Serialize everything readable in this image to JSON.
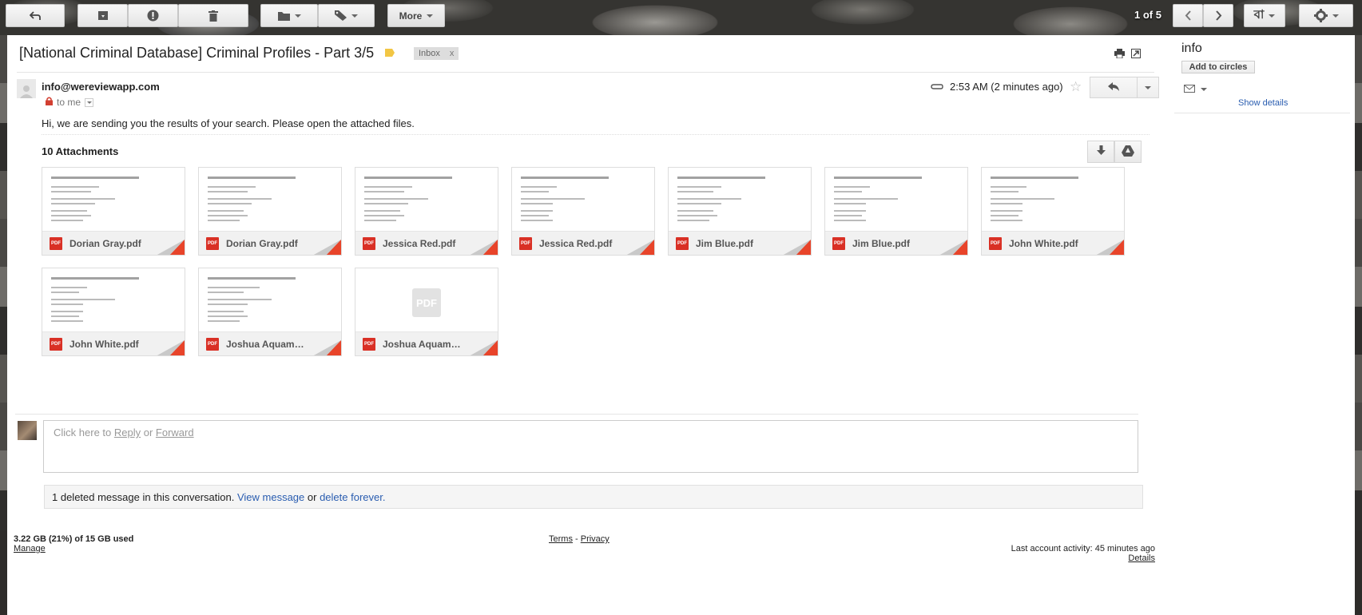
{
  "toolbar": {
    "more_label": "More",
    "page_count": "1 of 5",
    "input_tool_label": "বা"
  },
  "email": {
    "subject": "[National Criminal Database] Criminal Profiles - Part 3/5",
    "label_chip": "Inbox",
    "label_chip_close": "x",
    "sender": "info@wereviewapp.com",
    "recipient": "to me",
    "time": "2:53 AM (2 minutes ago)",
    "body": "Hi, we are sending you the results of your search. Please open the attached files."
  },
  "attachments": {
    "title": "10 Attachments",
    "badge": "PDF",
    "items": [
      {
        "name": "Dorian Gray.pdf"
      },
      {
        "name": "Dorian Gray.pdf"
      },
      {
        "name": "Jessica Red.pdf"
      },
      {
        "name": "Jessica Red.pdf"
      },
      {
        "name": "Jim Blue.pdf"
      },
      {
        "name": "Jim Blue.pdf"
      },
      {
        "name": "John White.pdf"
      },
      {
        "name": "John White.pdf"
      },
      {
        "name": "Joshua Aquamar..."
      },
      {
        "name": "Joshua Aquamar..."
      }
    ]
  },
  "reply": {
    "prefix": "Click here to ",
    "reply_link": "Reply",
    "or": " or ",
    "forward_link": "Forward"
  },
  "deleted": {
    "text": "1 deleted message in this conversation. ",
    "view_link": "View message",
    "or": " or ",
    "delete_link": "delete forever."
  },
  "footer": {
    "storage": "3.22 GB (21%) of 15 GB used",
    "manage": "Manage",
    "terms": "Terms",
    "sep": " - ",
    "privacy": "Privacy",
    "activity": "Last account activity: 45 minutes ago",
    "details": "Details"
  },
  "sidebar": {
    "name": "info",
    "add_to_circles": "Add to circles",
    "show_details": "Show details"
  },
  "colors": {
    "pdf_red": "#d93025",
    "link_blue": "#2a5db0",
    "label_yellow": "#f2c644"
  }
}
